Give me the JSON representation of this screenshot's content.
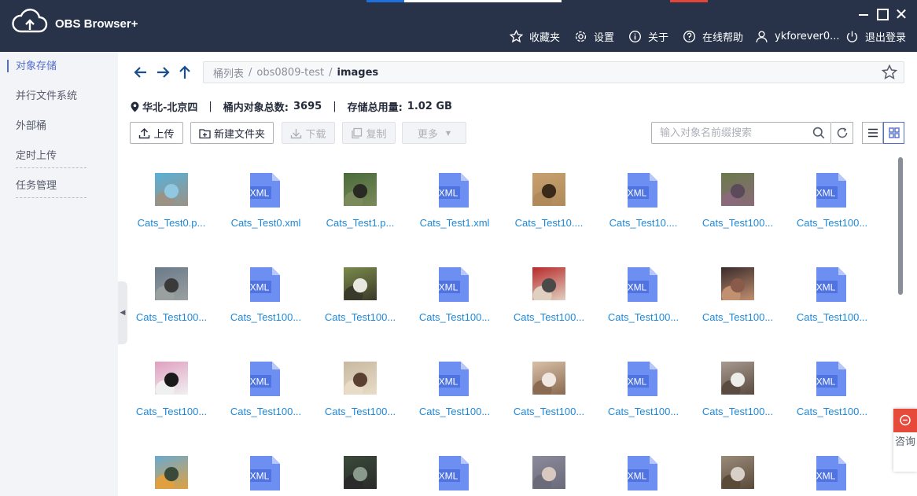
{
  "app": {
    "name": "OBS Browser+"
  },
  "colors": {
    "titlebar": "#283349",
    "accent": "#526ecc",
    "link": "#1e88d8",
    "xml_icon": "#6e8ff2",
    "consult": "#e64a3b"
  },
  "topnav": {
    "favorites": "收藏夹",
    "settings": "设置",
    "about": "关于",
    "help": "在线帮助",
    "user": "ykforever0...",
    "logout": "退出登录"
  },
  "sidebar": {
    "items": [
      {
        "label": "对象存储",
        "active": true
      },
      {
        "label": "并行文件系统"
      },
      {
        "label": "外部桶"
      },
      {
        "label": "定时上传"
      },
      {
        "label": "任务管理"
      }
    ]
  },
  "path": {
    "root": "桶列表",
    "bucket": "obs0809-test",
    "current": "images"
  },
  "info": {
    "region": "华北-北京四",
    "object_count_label": "桶内对象总数:",
    "object_count": "3695",
    "usage_label": "存储总用量:",
    "usage": "1.02 GB"
  },
  "toolbar": {
    "upload": "上传",
    "new_folder": "新建文件夹",
    "download": "下载",
    "copy": "复制",
    "more": "更多"
  },
  "search": {
    "placeholder": "输入对象名前缀搜索",
    "value": ""
  },
  "consult": {
    "label": "咨询"
  },
  "files": [
    {
      "name": "Cats_Test0.p...",
      "type": "image",
      "palette": [
        "#5ab0d8",
        "#8fc8e0",
        "#9a9284"
      ]
    },
    {
      "name": "Cats_Test0.xml",
      "type": "xml"
    },
    {
      "name": "Cats_Test1.p...",
      "type": "image",
      "palette": [
        "#4a6a3a",
        "#2a2a24",
        "#7a8a5a"
      ]
    },
    {
      "name": "Cats_Test1.xml",
      "type": "xml"
    },
    {
      "name": "Cats_Test10....",
      "type": "image",
      "palette": [
        "#c8a070",
        "#3a2a1a",
        "#b08a5a"
      ]
    },
    {
      "name": "Cats_Test10....",
      "type": "xml"
    },
    {
      "name": "Cats_Test100...",
      "type": "image",
      "palette": [
        "#6a7a4a",
        "#5a4a5a",
        "#8a6a7a"
      ]
    },
    {
      "name": "Cats_Test100...",
      "type": "xml"
    },
    {
      "name": "Cats_Test100...",
      "type": "image",
      "palette": [
        "#6a7a8a",
        "#3a3a3a",
        "#9aa0a0"
      ]
    },
    {
      "name": "Cats_Test100...",
      "type": "xml"
    },
    {
      "name": "Cats_Test100...",
      "type": "image",
      "palette": [
        "#7a8a4a",
        "#e8e8e0",
        "#3a3a2a"
      ]
    },
    {
      "name": "Cats_Test100...",
      "type": "xml"
    },
    {
      "name": "Cats_Test100...",
      "type": "image",
      "palette": [
        "#b82a2a",
        "#4a4a4a",
        "#e0d0c0"
      ]
    },
    {
      "name": "Cats_Test100...",
      "type": "xml"
    },
    {
      "name": "Cats_Test100...",
      "type": "image",
      "palette": [
        "#3a2a2a",
        "#8a5a4a",
        "#c09070"
      ]
    },
    {
      "name": "Cats_Test100...",
      "type": "xml"
    },
    {
      "name": "Cats_Test100...",
      "type": "image",
      "palette": [
        "#e0a0c0",
        "#1a1a1a",
        "#f0f0f0"
      ]
    },
    {
      "name": "Cats_Test100...",
      "type": "xml"
    },
    {
      "name": "Cats_Test100...",
      "type": "image",
      "palette": [
        "#c8b8a0",
        "#5a4030",
        "#e8dcc8"
      ]
    },
    {
      "name": "Cats_Test100...",
      "type": "xml"
    },
    {
      "name": "Cats_Test100...",
      "type": "image",
      "palette": [
        "#d8c0a8",
        "#f0e8e0",
        "#8a6a50"
      ]
    },
    {
      "name": "Cats_Test100...",
      "type": "xml"
    },
    {
      "name": "Cats_Test100...",
      "type": "image",
      "palette": [
        "#a89a90",
        "#ecece8",
        "#5a4a40"
      ]
    },
    {
      "name": "Cats_Test100...",
      "type": "xml"
    },
    {
      "name": "",
      "type": "image",
      "palette": [
        "#6aaad0",
        "#3a4a3a",
        "#e0a040"
      ]
    },
    {
      "name": "",
      "type": "xml"
    },
    {
      "name": "",
      "type": "image",
      "palette": [
        "#3a4a3a",
        "#8a9a8a",
        "#2a2a2a"
      ]
    },
    {
      "name": "",
      "type": "xml"
    },
    {
      "name": "",
      "type": "image",
      "palette": [
        "#8a8a9a",
        "#d8c8c0",
        "#6a6a7a"
      ]
    },
    {
      "name": "",
      "type": "xml"
    },
    {
      "name": "",
      "type": "image",
      "palette": [
        "#9a8a7a",
        "#d8d0c8",
        "#5a4a3a"
      ]
    },
    {
      "name": "",
      "type": "xml"
    }
  ]
}
